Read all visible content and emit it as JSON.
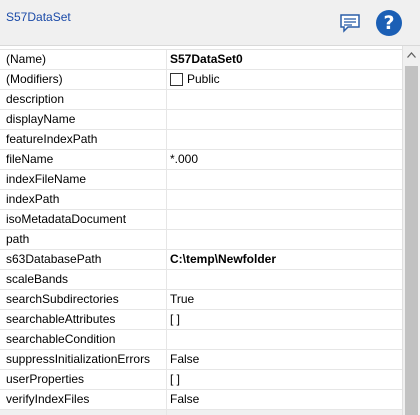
{
  "header": {
    "title": "S57DataSet",
    "comment_icon": "comment-icon",
    "help_icon": "help-icon",
    "help_glyph": "?"
  },
  "properties": [
    {
      "name": "(Name)",
      "value": "S57DataSet0",
      "bold": true
    },
    {
      "name": "(Modifiers)",
      "value": "Public",
      "checkbox": true
    },
    {
      "name": "description",
      "value": ""
    },
    {
      "name": "displayName",
      "value": ""
    },
    {
      "name": "featureIndexPath",
      "value": ""
    },
    {
      "name": "fileName",
      "value": "*.000"
    },
    {
      "name": "indexFileName",
      "value": ""
    },
    {
      "name": "indexPath",
      "value": ""
    },
    {
      "name": "isoMetadataDocument",
      "value": ""
    },
    {
      "name": "path",
      "value": ""
    },
    {
      "name": "s63DatabasePath",
      "value": "C:\\temp\\Newfolder",
      "bold": true
    },
    {
      "name": "scaleBands",
      "value": ""
    },
    {
      "name": "searchSubdirectories",
      "value": "True"
    },
    {
      "name": "searchableAttributes",
      "value": "[ ]"
    },
    {
      "name": "searchableCondition",
      "value": ""
    },
    {
      "name": "suppressInitializationErrors",
      "value": "False"
    },
    {
      "name": "userProperties",
      "value": "[ ]"
    },
    {
      "name": "verifyIndexFiles",
      "value": "False"
    },
    {
      "name": "",
      "value": "",
      "partial": true
    }
  ],
  "scrollbar": {
    "up_icon": "chevron-up-icon"
  }
}
